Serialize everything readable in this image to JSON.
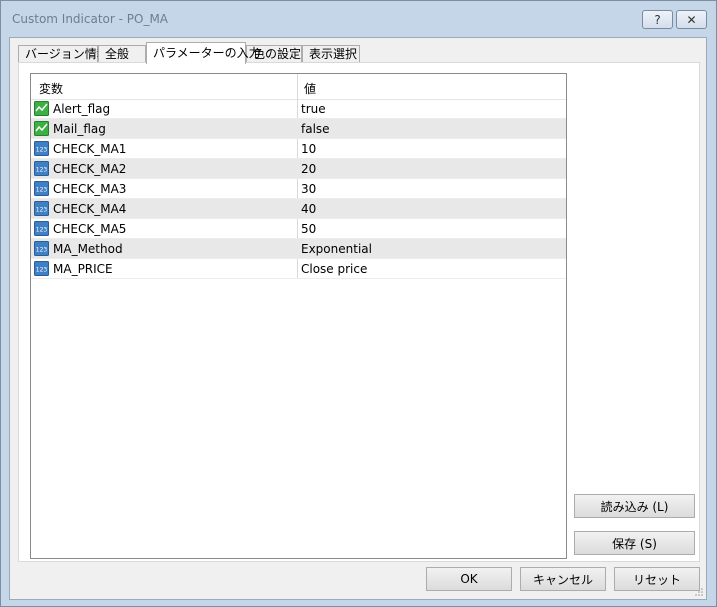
{
  "window": {
    "title": "Custom Indicator - PO_MA",
    "help_label": "?",
    "close_label": "✕"
  },
  "tabs": [
    {
      "label": "バージョン情報"
    },
    {
      "label": "全般"
    },
    {
      "label": "パラメーターの入力"
    },
    {
      "label": "色の設定"
    },
    {
      "label": "表示選択"
    }
  ],
  "active_tab": "パラメーターの入力",
  "table": {
    "headers": {
      "variable": "変数",
      "value": "値"
    },
    "rows": [
      {
        "name": "Alert_flag",
        "value": "true",
        "icon": "bool-icon"
      },
      {
        "name": "Mail_flag",
        "value": "false",
        "icon": "bool-icon"
      },
      {
        "name": "CHECK_MA1",
        "value": "10",
        "icon": "number-icon"
      },
      {
        "name": "CHECK_MA2",
        "value": "20",
        "icon": "number-icon"
      },
      {
        "name": "CHECK_MA3",
        "value": "30",
        "icon": "number-icon"
      },
      {
        "name": "CHECK_MA4",
        "value": "40",
        "icon": "number-icon"
      },
      {
        "name": "CHECK_MA5",
        "value": "50",
        "icon": "number-icon"
      },
      {
        "name": "MA_Method",
        "value": "Exponential",
        "icon": "number-icon"
      },
      {
        "name": "MA_PRICE",
        "value": "Close price",
        "icon": "number-icon"
      }
    ]
  },
  "side_buttons": {
    "load_label": "読み込み (L)",
    "save_label": "保存 (S)"
  },
  "footer": {
    "ok_label": "OK",
    "cancel_label": "キャンセル",
    "reset_label": "リセット"
  },
  "colors": {
    "bool_icon": "#3cb043",
    "number_icon": "#3f7fc4",
    "row_alt": "#e8e8e8",
    "window_frame": "#c5d6e8"
  }
}
